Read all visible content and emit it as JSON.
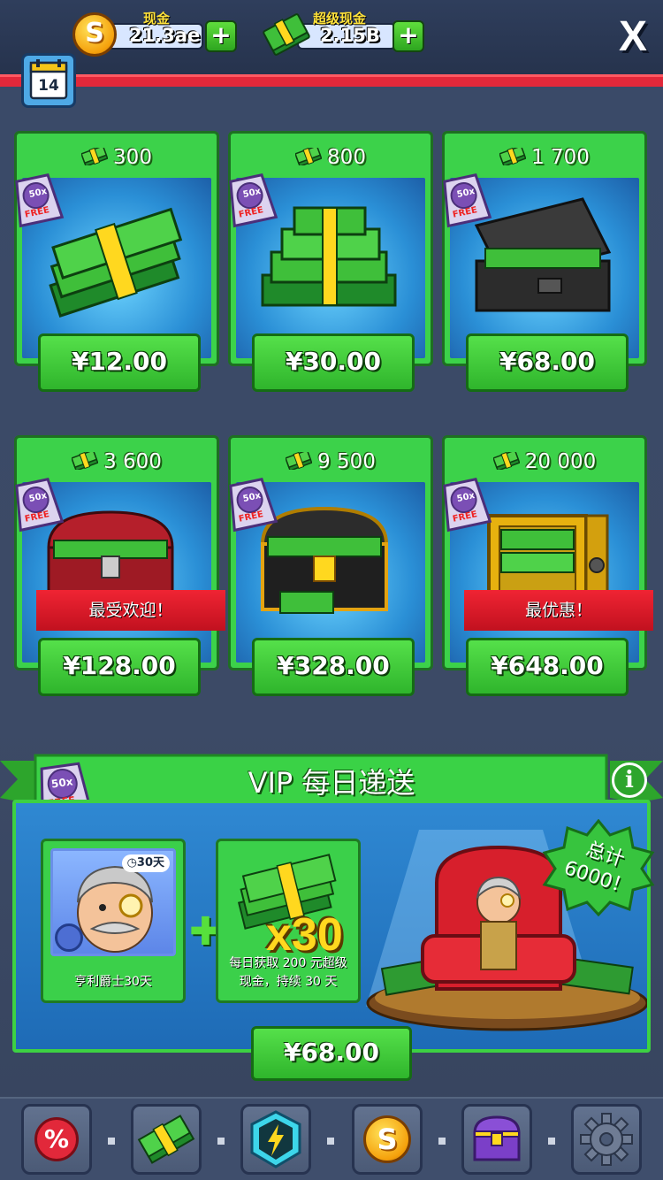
{
  "header": {
    "cash": {
      "label": "现金",
      "value": "21.3ae",
      "add": "+"
    },
    "super_cash": {
      "label": "超级现金",
      "value": "2.15B",
      "add": "+"
    },
    "close": "X",
    "calendar_day": "14"
  },
  "packs": [
    {
      "amount": "300",
      "price": "¥12.00",
      "badge": "50x",
      "free": "FREE",
      "ribbon": ""
    },
    {
      "amount": "800",
      "price": "¥30.00",
      "badge": "50x",
      "free": "FREE",
      "ribbon": ""
    },
    {
      "amount": "1 700",
      "price": "¥68.00",
      "badge": "50x",
      "free": "FREE",
      "ribbon": ""
    },
    {
      "amount": "3 600",
      "price": "¥128.00",
      "badge": "50x",
      "free": "FREE",
      "ribbon": "最受欢迎！"
    },
    {
      "amount": "9 500",
      "price": "¥328.00",
      "badge": "50x",
      "free": "FREE",
      "ribbon": ""
    },
    {
      "amount": "20 000",
      "price": "¥648.00",
      "badge": "50x",
      "free": "FREE",
      "ribbon": "最优惠！"
    }
  ],
  "vip": {
    "title": "VIP 每日递送",
    "info": "i",
    "badge": "50x",
    "free": "FREE",
    "manager_timer": "30天",
    "manager_caption": "亨利爵士30天",
    "cash_multiplier": "x30",
    "cash_caption_1": "每日获取 200 元超级",
    "cash_caption_2": "现金，持续 30 天",
    "total_1": "总计",
    "total_2": "6000！",
    "price": "¥68.00"
  },
  "nav": {
    "items": [
      "discount-icon",
      "cash-stack-icon",
      "boost-gem-icon",
      "coin-icon",
      "treasure-chest-icon",
      "settings-gear-icon"
    ],
    "discount_symbol": "%",
    "coin_symbol": "S"
  },
  "colors": {
    "accent_green": "#3cd24a",
    "price_green": "#2fb52c",
    "ribbon_red": "#e2283a",
    "background": "#3a4a68",
    "panel_blue": "#2a8fd6",
    "gold": "#ffd81f"
  }
}
